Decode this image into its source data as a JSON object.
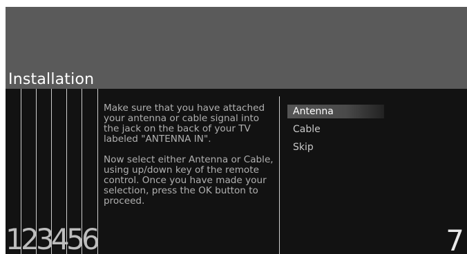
{
  "header": {
    "title": "Installation"
  },
  "steps": {
    "completed": [
      "1",
      "2",
      "3",
      "4",
      "5",
      "6"
    ],
    "current": "7"
  },
  "instructions": {
    "paragraph1": "Make sure that you have attached your antenna or cable signal into the jack on the back of your TV labeled \"ANTENNA IN\".",
    "paragraph2": "Now select either Antenna or Cable, using up/down key of the remote control. Once you have made your selection, press the OK button to proceed."
  },
  "menu": {
    "items": [
      {
        "label": "Antenna",
        "selected": true
      },
      {
        "label": "Cable",
        "selected": false
      },
      {
        "label": "Skip",
        "selected": false
      }
    ]
  }
}
